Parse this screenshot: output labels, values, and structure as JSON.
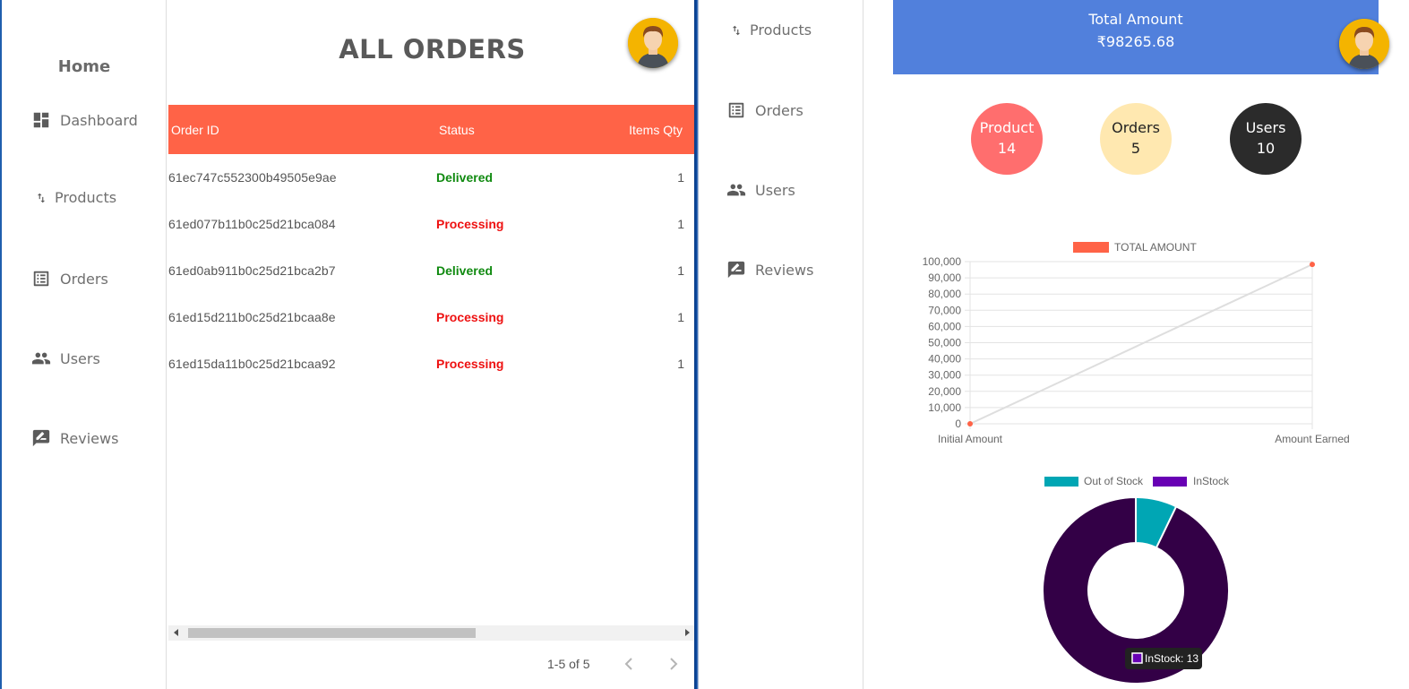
{
  "left_window": {
    "sidebar": {
      "home_label": "Home",
      "items": [
        {
          "label": "Dashboard",
          "icon": "dashboard-icon"
        },
        {
          "label": "Products",
          "icon": "sort-arrows-icon"
        },
        {
          "label": "Orders",
          "icon": "list-alt-icon"
        },
        {
          "label": "Users",
          "icon": "people-icon"
        },
        {
          "label": "Reviews",
          "icon": "rate-review-icon"
        }
      ]
    },
    "page_title": "ALL ORDERS",
    "table": {
      "columns": [
        "Order ID",
        "Status",
        "Items Qty"
      ],
      "rows": [
        {
          "order_id": "61ec747c552300b49505e9ae",
          "status": "Delivered",
          "qty": "1"
        },
        {
          "order_id": "61ed077b11b0c25d21bca084",
          "status": "Processing",
          "qty": "1"
        },
        {
          "order_id": "61ed0ab911b0c25d21bca2b7",
          "status": "Delivered",
          "qty": "1"
        },
        {
          "order_id": "61ed15d211b0c25d21bcaa8e",
          "status": "Processing",
          "qty": "1"
        },
        {
          "order_id": "61ed15da11b0c25d21bcaa92",
          "status": "Processing",
          "qty": "1"
        }
      ]
    },
    "pagination": {
      "range_text": "1-5 of 5"
    },
    "colors": {
      "header": "#ff6347",
      "delivered": "#108a10",
      "processing": "#ee1111"
    }
  },
  "right_window": {
    "sidebar": {
      "items": [
        {
          "label": "Products",
          "icon": "sort-arrows-icon"
        },
        {
          "label": "Orders",
          "icon": "list-alt-icon"
        },
        {
          "label": "Users",
          "icon": "people-icon"
        },
        {
          "label": "Reviews",
          "icon": "rate-review-icon"
        }
      ]
    },
    "total_card": {
      "label": "Total Amount",
      "value": "₹98265.68",
      "color": "#5180dc"
    },
    "summary": [
      {
        "label": "Product",
        "value": "14",
        "color": "#ff6e6e"
      },
      {
        "label": "Orders",
        "value": "5",
        "color": "#ffe8b0"
      },
      {
        "label": "Users",
        "value": "10",
        "color": "#2b2b2b"
      }
    ]
  },
  "chart_data": [
    {
      "type": "line",
      "categories": [
        "Initial Amount",
        "Amount Earned"
      ],
      "series": [
        {
          "name": "TOTAL AMOUNT",
          "values": [
            0,
            98265.68
          ],
          "color": "#ff6347"
        }
      ],
      "ylim": [
        0,
        100000
      ],
      "yticks": [
        "100,000",
        "90,000",
        "80,000",
        "70,000",
        "60,000",
        "50,000",
        "40,000",
        "30,000",
        "20,000",
        "10,000",
        "0"
      ],
      "grid": true,
      "legend": "top"
    },
    {
      "type": "pie",
      "variant": "doughnut",
      "labels": [
        "Out of Stock",
        "InStock"
      ],
      "values": [
        1,
        13
      ],
      "colors": [
        "#00a6b4",
        "#6800b4"
      ],
      "legend": "top",
      "tooltip": "InStock: 13"
    }
  ]
}
